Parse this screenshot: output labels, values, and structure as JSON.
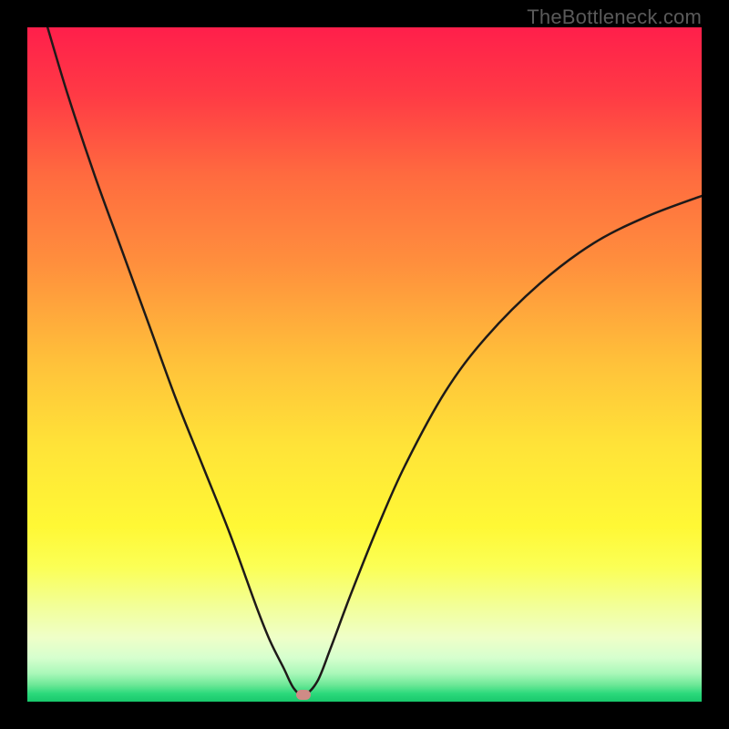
{
  "watermark": "TheBottleneck.com",
  "colors": {
    "frame": "#000000",
    "curve_stroke": "#1e1a19",
    "marker": "#cf8b86",
    "gradient_stops": [
      {
        "offset": 0.0,
        "color": "#ff1f4b"
      },
      {
        "offset": 0.1,
        "color": "#ff3a45"
      },
      {
        "offset": 0.22,
        "color": "#ff6b3f"
      },
      {
        "offset": 0.35,
        "color": "#ff8f3d"
      },
      {
        "offset": 0.5,
        "color": "#ffc23a"
      },
      {
        "offset": 0.62,
        "color": "#ffe338"
      },
      {
        "offset": 0.74,
        "color": "#fff835"
      },
      {
        "offset": 0.8,
        "color": "#fbff55"
      },
      {
        "offset": 0.86,
        "color": "#f2ff9a"
      },
      {
        "offset": 0.905,
        "color": "#efffc8"
      },
      {
        "offset": 0.935,
        "color": "#d6ffce"
      },
      {
        "offset": 0.958,
        "color": "#aaf8b9"
      },
      {
        "offset": 0.975,
        "color": "#6de897"
      },
      {
        "offset": 0.988,
        "color": "#2bd97b"
      },
      {
        "offset": 1.0,
        "color": "#18c86c"
      }
    ]
  },
  "chart_data": {
    "type": "line",
    "title": "",
    "xlabel": "",
    "ylabel": "",
    "xlim": [
      0,
      100
    ],
    "ylim": [
      0,
      100
    ],
    "grid": false,
    "legend": false,
    "annotations": [
      "TheBottleneck.com"
    ],
    "min_marker": {
      "x": 41,
      "y": 1
    },
    "series": [
      {
        "name": "bottleneck-curve",
        "x": [
          3,
          6,
          10,
          14,
          18,
          22,
          26,
          30,
          34,
          36,
          38,
          39.5,
          41,
          43,
          45,
          48,
          52,
          56,
          62,
          68,
          76,
          84,
          92,
          100
        ],
        "y": [
          100,
          90,
          78,
          67,
          56,
          45,
          35,
          25,
          14,
          9,
          5,
          2,
          1,
          3,
          8,
          16,
          26,
          35,
          46,
          54,
          62,
          68,
          72,
          75
        ]
      }
    ]
  }
}
